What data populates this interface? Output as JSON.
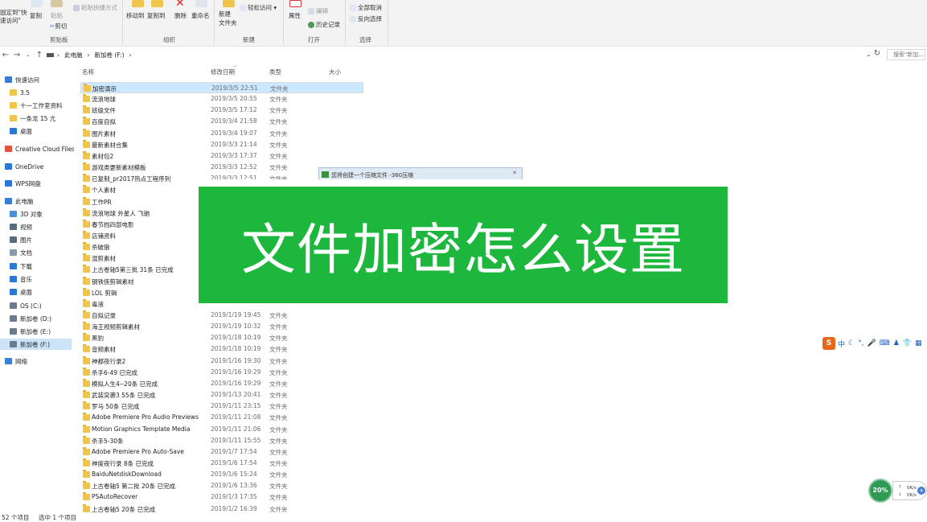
{
  "ribbon": {
    "pin_quick": "固定到\"快\n速访问\"",
    "copy": "复制",
    "paste": "粘贴",
    "paste_shortcut": "粘贴快捷方式",
    "cut": "剪切",
    "clipboard_group": "剪贴板",
    "move_to": "移动到",
    "copy_to": "复制到",
    "delete": "删除",
    "rename": "重命名",
    "organize_group": "组织",
    "new_folder": "新建\n文件夹",
    "easy_access": "轻松访问",
    "new_group": "新建",
    "properties": "属性",
    "edit": "编辑",
    "history": "历史记录",
    "open_group": "打开",
    "select_all": "全部取消",
    "invert": "反向选择",
    "select_group": "选择"
  },
  "address": {
    "crumb1": "此电脑",
    "crumb2": "新加卷 (F:)",
    "search_placeholder": "搜索\"新加..."
  },
  "nav": [
    {
      "label": "快速访问",
      "icon": "star-icon",
      "color": "#3a7bd5",
      "sub": false
    },
    {
      "label": "3.5",
      "icon": "folder-icon",
      "color": "#f0c54a",
      "sub": true
    },
    {
      "label": "十一工作室资料",
      "icon": "folder-icon",
      "color": "#f0c54a",
      "sub": true
    },
    {
      "label": "一条龙 15 亢",
      "icon": "folder-icon",
      "color": "#f0c54a",
      "sub": true
    },
    {
      "label": "桌面",
      "icon": "desktop-icon",
      "color": "#2b78d6",
      "sub": true
    },
    {
      "label": "Creative Cloud Files",
      "icon": "creative-cloud-icon",
      "color": "#e0533f",
      "sub": false
    },
    {
      "label": "OneDrive",
      "icon": "onedrive-icon",
      "color": "#2b78d6",
      "sub": false
    },
    {
      "label": "WPS网盘",
      "icon": "wps-cloud-icon",
      "color": "#2b78d6",
      "sub": false
    },
    {
      "label": "此电脑",
      "icon": "computer-icon",
      "color": "#3b7dd8",
      "sub": false
    },
    {
      "label": "3D 对象",
      "icon": "3d-objects-icon",
      "color": "#4a90d9",
      "sub": true
    },
    {
      "label": "视频",
      "icon": "video-icon",
      "color": "#5a6c80",
      "sub": true
    },
    {
      "label": "图片",
      "icon": "pictures-icon",
      "color": "#5a6c80",
      "sub": true
    },
    {
      "label": "文档",
      "icon": "documents-icon",
      "color": "#8a9aae",
      "sub": true
    },
    {
      "label": "下载",
      "icon": "downloads-icon",
      "color": "#2b78d6",
      "sub": true
    },
    {
      "label": "音乐",
      "icon": "music-icon",
      "color": "#2b78d6",
      "sub": true
    },
    {
      "label": "桌面",
      "icon": "desktop-icon",
      "color": "#2b78d6",
      "sub": true
    },
    {
      "label": "OS (C:)",
      "icon": "drive-icon",
      "color": "#6b7b8c",
      "sub": true
    },
    {
      "label": "新加卷 (D:)",
      "icon": "drive-icon",
      "color": "#6b7b8c",
      "sub": true
    },
    {
      "label": "新加卷 (E:)",
      "icon": "drive-icon",
      "color": "#6b7b8c",
      "sub": true
    },
    {
      "label": "新加卷 (F:)",
      "icon": "drive-icon",
      "color": "#6b7b8c",
      "sub": true,
      "selected": true
    },
    {
      "label": "网络",
      "icon": "network-icon",
      "color": "#3b7dd8",
      "sub": false
    }
  ],
  "columns": {
    "name": "名称",
    "date": "修改日期",
    "type": "类型",
    "size": "大小"
  },
  "files": [
    {
      "name": "加密演示",
      "date": "2019/3/5 22:51",
      "type": "文件夹",
      "selected": true
    },
    {
      "name": "流浪地球",
      "date": "2019/3/5 20:55",
      "type": "文件夹"
    },
    {
      "name": "班级文件",
      "date": "2019/3/5 17:12",
      "type": "文件夹"
    },
    {
      "name": "百度自拟",
      "date": "2019/3/4 21:58",
      "type": "文件夹"
    },
    {
      "name": "图片素材",
      "date": "2019/3/4 19:07",
      "type": "文件夹"
    },
    {
      "name": "最新素材合集",
      "date": "2019/3/3 21:14",
      "type": "文件夹"
    },
    {
      "name": "素材包2",
      "date": "2019/3/3 17:37",
      "type": "文件夹"
    },
    {
      "name": "游戏类更新素材模板",
      "date": "2019/3/3 12:52",
      "type": "文件夹"
    },
    {
      "name": "已复制_pr2017热点工程序列",
      "date": "2019/3/3 12:51",
      "type": "文件夹"
    },
    {
      "name": "个人素材",
      "date": "",
      "type": ""
    },
    {
      "name": "工作PR",
      "date": "",
      "type": ""
    },
    {
      "name": "流浪地球 外星人 飞驰",
      "date": "",
      "type": ""
    },
    {
      "name": "春节档四部电影",
      "date": "",
      "type": ""
    },
    {
      "name": "店铺资料",
      "date": "",
      "type": ""
    },
    {
      "name": "杀破狼",
      "date": "",
      "type": ""
    },
    {
      "name": "混剪素材",
      "date": "",
      "type": ""
    },
    {
      "name": "上古卷轴5第三批 31条 已完成",
      "date": "",
      "type": ""
    },
    {
      "name": "钢铁侠剪辑素材",
      "date": "",
      "type": ""
    },
    {
      "name": "LOL 剪辑",
      "date": "",
      "type": ""
    },
    {
      "name": "毒液",
      "date": "",
      "type": ""
    },
    {
      "name": "自拟记录",
      "date": "2019/1/19 19:45",
      "type": "文件夹"
    },
    {
      "name": "海王视频剪辑素材",
      "date": "2019/1/19 10:32",
      "type": "文件夹"
    },
    {
      "name": "黑豹",
      "date": "2019/1/18 10:19",
      "type": "文件夹"
    },
    {
      "name": "音频素材",
      "date": "2019/1/18 10:19",
      "type": "文件夹"
    },
    {
      "name": "神都夜行录2",
      "date": "2019/1/16 19:30",
      "type": "文件夹"
    },
    {
      "name": "杀手6-49 已完成",
      "date": "2019/1/16 19:29",
      "type": "文件夹"
    },
    {
      "name": "模拟人生4--20条 已完成",
      "date": "2019/1/16 19:29",
      "type": "文件夹"
    },
    {
      "name": "武装突袭3 55条 已完成",
      "date": "2019/1/13 20:41",
      "type": "文件夹"
    },
    {
      "name": "罗马 50条 已完成",
      "date": "2019/1/11 23:15",
      "type": "文件夹"
    },
    {
      "name": "Adobe Premiere Pro Audio Previews",
      "date": "2019/1/11 21:08",
      "type": "文件夹"
    },
    {
      "name": "Motion Graphics Template Media",
      "date": "2019/1/11 21:06",
      "type": "文件夹"
    },
    {
      "name": "杀手5-30条",
      "date": "2019/1/11 15:55",
      "type": "文件夹"
    },
    {
      "name": "Adobe Premiere Pro Auto-Save",
      "date": "2019/1/7 17:54",
      "type": "文件夹"
    },
    {
      "name": "神度夜行录 8条 已完成",
      "date": "2019/1/6 17:54",
      "type": "文件夹"
    },
    {
      "name": "BaiduNetdiskDownload",
      "date": "2019/1/6 15:24",
      "type": "文件夹"
    },
    {
      "name": "上古卷轴5 第二批 20条 已完成",
      "date": "2019/1/6 13:36",
      "type": "文件夹"
    },
    {
      "name": "PSAutoRecover",
      "date": "2019/1/3 17:35",
      "type": "文件夹"
    },
    {
      "name": "上古卷轴5 20条 已完成",
      "date": "2019/1/2 16:39",
      "type": "文件夹"
    }
  ],
  "popup": {
    "title": "您将创建一个压缩文件 -360压缩",
    "close": "✕"
  },
  "banner": {
    "text": "文件加密怎么设置",
    "color": "#1db73d"
  },
  "ime": {
    "logo": "S",
    "mode": "中"
  },
  "speed": {
    "percent": "20%",
    "up": "0K/s",
    "down": "0K/s"
  },
  "status": {
    "count": "52 个项目",
    "selected": "选中 1 个项目"
  }
}
